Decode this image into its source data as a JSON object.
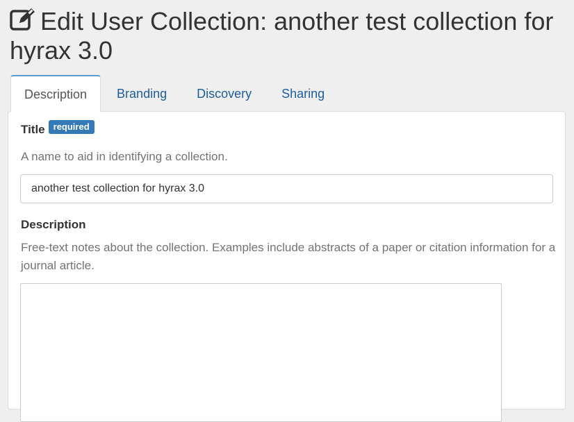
{
  "header": {
    "title": "Edit User Collection: another test collection for hyrax 3.0",
    "icon": "edit-icon"
  },
  "tabs": [
    {
      "label": "Description",
      "active": true
    },
    {
      "label": "Branding",
      "active": false
    },
    {
      "label": "Discovery",
      "active": false
    },
    {
      "label": "Sharing",
      "active": false
    }
  ],
  "form": {
    "title_field": {
      "label": "Title",
      "badge": "required",
      "help": "A name to aid in identifying a collection.",
      "value": "another test collection for hyrax 3.0"
    },
    "description_field": {
      "label": "Description",
      "help": "Free-text notes about the collection. Examples include abstracts of a paper or citation information for a journal article.",
      "value": ""
    }
  },
  "colors": {
    "link": "#1d5ea0",
    "badge": "#337ab7",
    "background": "#efefef"
  }
}
